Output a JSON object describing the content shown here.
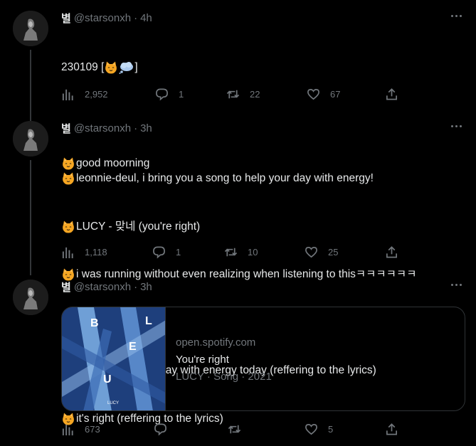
{
  "author": {
    "name": "별",
    "handle": "@starsonxh"
  },
  "tweets": [
    {
      "time": "4h",
      "lines": [
        "230109 [",
        "]",
        "",
        "good moorning"
      ],
      "stats": {
        "views": "2,952",
        "replies": "1",
        "retweets": "22",
        "likes": "67"
      }
    },
    {
      "time": "3h",
      "lines": [
        "leonnie-deul, i bring you a song to help your day with energy!",
        "LUCY - 맞네 (you're right)",
        "i was running without even realizing when listening to thisㅋㅋㅋㅋㅋㅋ",
        "ㅋㅋ",
        "(y/n) can start ur day with energy today (reffering to the lyrics)",
        "it's right (reffering to the lyrics)"
      ],
      "stats": {
        "views": "1,118",
        "replies": "1",
        "retweets": "10",
        "likes": "25"
      }
    },
    {
      "time": "3h",
      "card": {
        "domain": "open.spotify.com",
        "title": "You're right",
        "subtitle": "LUCY · Song · 2021",
        "art_letters": [
          "B",
          "L",
          "E",
          "U"
        ],
        "art_caption": "LUCY"
      },
      "stats": {
        "views": "673",
        "replies": "",
        "retweets": "",
        "likes": "5"
      }
    }
  ],
  "icons": {
    "views": "bar-chart-icon",
    "reply": "speech-bubble-icon",
    "retweet": "retweet-arrows-icon",
    "like": "heart-icon",
    "share": "share-upload-icon",
    "more": "more-dots-icon",
    "emoji": "cat-face-emoji",
    "cloud": "thought-balloon-emoji"
  },
  "colors": {
    "background": "#000000",
    "text": "#e7e9ea",
    "muted": "#71767b",
    "border": "#2f3336"
  }
}
